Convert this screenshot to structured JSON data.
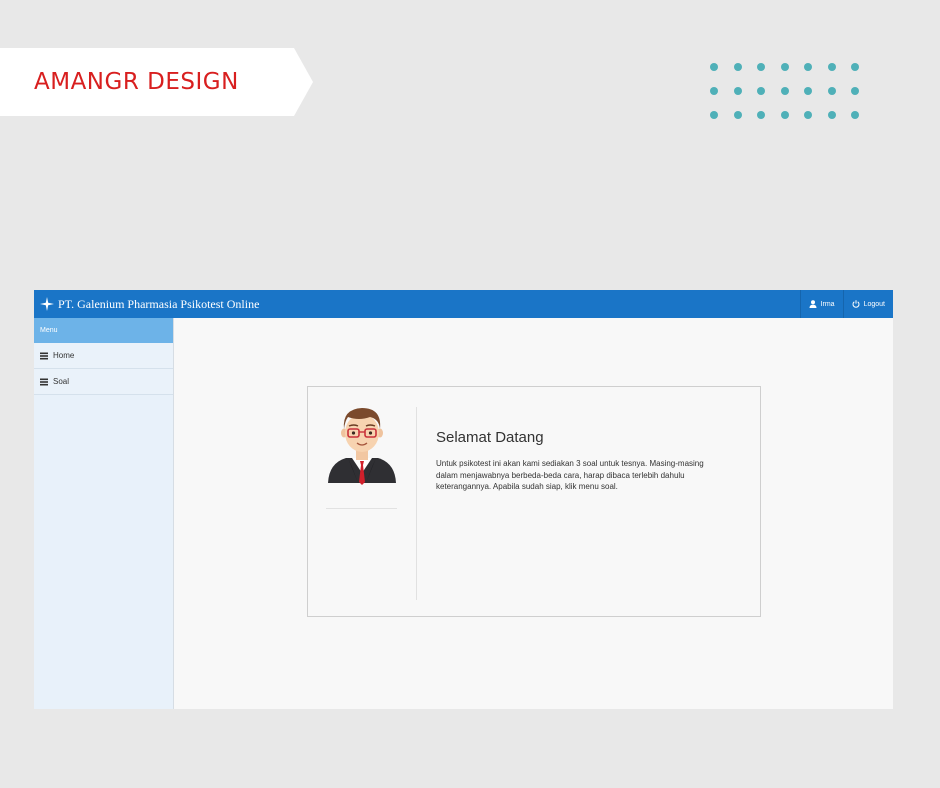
{
  "banner": {
    "text": "AMANGR DESIGN",
    "text_color": "#d81f1f"
  },
  "decor": {
    "dot_color": "#4fb0b8",
    "dot_rows": 3,
    "dot_cols": 7
  },
  "app": {
    "brand": "PT. Galenium Pharmasia Psikotest Online",
    "header_color": "#1a75c7",
    "user": {
      "icon": "user-icon",
      "label": "Irma"
    },
    "logout": {
      "icon": "power-icon",
      "label": "Logout"
    },
    "sidebar": {
      "header": "Menu",
      "items": [
        {
          "label": "Home",
          "icon": "list-icon"
        },
        {
          "label": "Soal",
          "icon": "list-icon"
        }
      ]
    },
    "main": {
      "title": "Selamat Datang",
      "description": "Untuk psikotest ini akan kami sediakan 3 soal untuk tesnya. Masing-masing dalam menjawabnya berbeda-beda cara, harap dibaca terlebih dahulu keterangannya. Apabila sudah siap, klik menu soal."
    }
  }
}
